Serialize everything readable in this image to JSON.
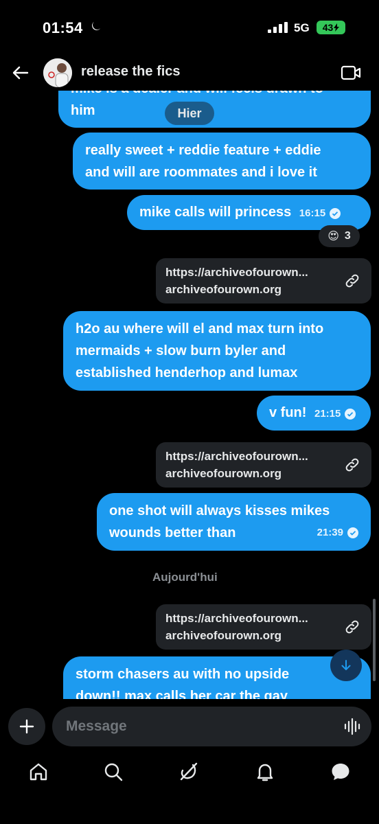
{
  "status_bar": {
    "time": "01:54",
    "network": "5G",
    "battery": "43"
  },
  "header": {
    "title": "release the fics",
    "back_icon": "back-arrow-icon",
    "video_icon": "video-camera-icon"
  },
  "messages": {
    "partial_top": {
      "line1": "mike is a dealer and will feels drawn to",
      "line2": "him"
    },
    "day_pill_1": "Hier",
    "m1": {
      "line1": "really sweet + reddie feature + eddie",
      "line2": "and will are roommates and i love it"
    },
    "m2": {
      "text": "mike calls will princess",
      "time": "16:15"
    },
    "reaction": {
      "emoji": "😍",
      "count": "3"
    },
    "link1": {
      "url": "https://archiveofourown...",
      "domain": "archiveofourown.org"
    },
    "m3": {
      "line1": "h2o au where will el and max turn into",
      "line2": "mermaids + slow burn byler and",
      "line3": "established henderhop and lumax"
    },
    "m4": {
      "text": "v fun!",
      "time": "21:15"
    },
    "link2": {
      "url": "https://archiveofourown...",
      "domain": "archiveofourown.org"
    },
    "m5": {
      "line1": "one shot will always kisses mikes",
      "line2": "wounds better than",
      "time": "21:39"
    },
    "day_label_2": "Aujourd'hui",
    "link3": {
      "url": "https://archiveofourown...",
      "domain": "archiveofourown.org"
    },
    "m6": {
      "line1": "storm chasers au with no upside",
      "line2": "down!! max calls her car the gay"
    }
  },
  "composer": {
    "placeholder": "Message"
  },
  "nav": [
    "home-icon",
    "search-icon",
    "grok-icon",
    "notifications-bell-icon",
    "messages-icon"
  ],
  "colors": {
    "bubble": "#1d9bf0",
    "background": "#000000",
    "card": "#202327"
  }
}
